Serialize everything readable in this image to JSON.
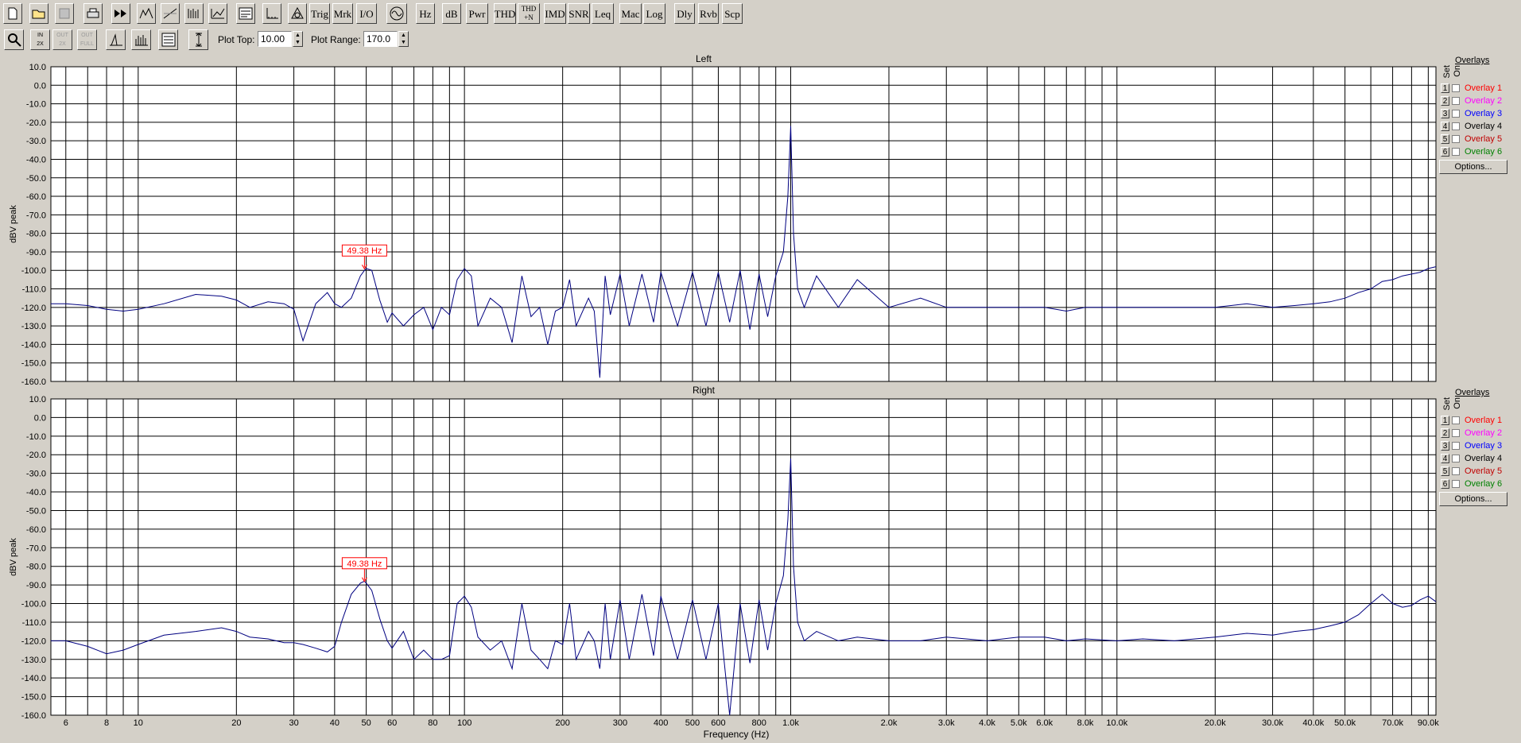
{
  "toolbar1": {
    "buttons": [
      {
        "name": "new-file-button",
        "icon": "new-file-icon",
        "label": ""
      },
      {
        "name": "open-file-button",
        "icon": "open-folder-icon",
        "label": ""
      },
      {
        "name": "save-file-button",
        "icon": "save-icon",
        "label": "",
        "disabled": true
      },
      {
        "name": "print-button",
        "icon": "printer-icon",
        "label": ""
      },
      {
        "name": "fast-forward-button",
        "icon": "fast-forward-icon",
        "label": ""
      },
      {
        "name": "spectrum-mode-button",
        "icon": "spectrum-icon",
        "label": ""
      },
      {
        "name": "waveform-button",
        "icon": "waveform-icon",
        "label": ""
      },
      {
        "name": "spectrogram-button",
        "icon": "spectrogram-icon",
        "label": ""
      },
      {
        "name": "3d-plot-button",
        "icon": "3d-plot-icon",
        "label": ""
      },
      {
        "name": "meters-button",
        "icon": "meters-icon",
        "label": ""
      },
      {
        "name": "axis-button",
        "icon": "axis-icon",
        "label": ""
      },
      {
        "name": "phase-button",
        "icon": "phase-icon",
        "label": ""
      },
      {
        "name": "trig-button",
        "icon": "",
        "label": "Trig"
      },
      {
        "name": "mrk-button",
        "icon": "",
        "label": "Mrk"
      },
      {
        "name": "io-button",
        "icon": "",
        "label": "I/O"
      },
      {
        "name": "generator-button",
        "icon": "generator-icon",
        "label": ""
      },
      {
        "name": "hz-button",
        "icon": "",
        "label": "Hz"
      },
      {
        "name": "db-button",
        "icon": "",
        "label": "dB"
      },
      {
        "name": "pwr-button",
        "icon": "",
        "label": "Pwr"
      },
      {
        "name": "thd-button",
        "icon": "",
        "label": "THD"
      },
      {
        "name": "thdn-button",
        "icon": "",
        "label": "THD\n+N"
      },
      {
        "name": "imd-button",
        "icon": "",
        "label": "IMD"
      },
      {
        "name": "snr-button",
        "icon": "",
        "label": "SNR"
      },
      {
        "name": "leq-button",
        "icon": "",
        "label": "Leq"
      },
      {
        "name": "mac-button",
        "icon": "",
        "label": "Mac"
      },
      {
        "name": "log-button",
        "icon": "",
        "label": "Log"
      },
      {
        "name": "dly-button",
        "icon": "",
        "label": "Dly"
      },
      {
        "name": "rvb-button",
        "icon": "",
        "label": "Rvb"
      },
      {
        "name": "scp-button",
        "icon": "",
        "label": "Scp"
      }
    ]
  },
  "toolbar2": {
    "buttons": [
      {
        "name": "zoom-button",
        "icon": "magnifier-icon",
        "label": ""
      },
      {
        "name": "zoom-in-2x-button",
        "icon": "zoom-in-icon",
        "label": "IN\n2X"
      },
      {
        "name": "zoom-out-2x-button",
        "icon": "zoom-out-icon",
        "label": "OUT\n2X",
        "disabled": true
      },
      {
        "name": "zoom-out-full-button",
        "icon": "zoom-out-full-icon",
        "label": "OUT\nFULL",
        "disabled": true
      },
      {
        "name": "peak-button",
        "icon": "peak-icon",
        "label": ""
      },
      {
        "name": "bars-button",
        "icon": "bars-icon",
        "label": ""
      },
      {
        "name": "settings-panel-button",
        "icon": "panel-icon",
        "label": ""
      },
      {
        "name": "vertical-scale-button",
        "icon": "vertical-scale-icon",
        "label": ""
      }
    ],
    "plot_top_label": "Plot Top:",
    "plot_top_value": "10.00",
    "plot_range_label": "Plot Range:",
    "plot_range_value": "170.0"
  },
  "overlays": {
    "title": "Overlays",
    "set_label": "Set",
    "on_label": "On",
    "items": [
      {
        "num": "1",
        "label": "Overlay 1",
        "color": "#ff0000"
      },
      {
        "num": "2",
        "label": "Overlay 2",
        "color": "#ff00ff"
      },
      {
        "num": "3",
        "label": "Overlay 3",
        "color": "#0000ff"
      },
      {
        "num": "4",
        "label": "Overlay 4",
        "color": "#000000"
      },
      {
        "num": "5",
        "label": "Overlay 5",
        "color": "#c00000"
      },
      {
        "num": "6",
        "label": "Overlay 6",
        "color": "#008000"
      }
    ],
    "options_label": "Options..."
  },
  "chart_data": [
    {
      "type": "line",
      "title": "Left",
      "ylabel": "dBV peak",
      "xlabel": "Frequency (Hz)",
      "xscale": "log",
      "xlim": [
        5.4,
        95000
      ],
      "ylim": [
        -160,
        10
      ],
      "yticks": [
        10,
        0,
        -10,
        -20,
        -30,
        -40,
        -50,
        -60,
        -70,
        -80,
        -90,
        -100,
        -110,
        -120,
        -130,
        -140,
        -150,
        -160
      ],
      "ytick_labels": [
        "10.0",
        "0.0",
        "-10.0",
        "-20.0",
        "-30.0",
        "-40.0",
        "-50.0",
        "-60.0",
        "-70.0",
        "-80.0",
        "-90.0",
        "-100.0",
        "-110.0",
        "-120.0",
        "-130.0",
        "-140.0",
        "-150.0",
        "-160.0"
      ],
      "line_color": "#000080",
      "marker": {
        "label": "49.38 Hz",
        "x": 49.38,
        "y": -100,
        "color": "#ff0000"
      },
      "series": [
        {
          "x": [
            5.4,
            6,
            7,
            8,
            9,
            10,
            12,
            15,
            18,
            20,
            22,
            25,
            28,
            30,
            32,
            35,
            38,
            40,
            42,
            45,
            48,
            49.38,
            50,
            52,
            55,
            58,
            60,
            65,
            70,
            75,
            80,
            85,
            90,
            95,
            100,
            105,
            110,
            120,
            130,
            140,
            150,
            160,
            170,
            180,
            190,
            200,
            210,
            220,
            240,
            250,
            260,
            270,
            280,
            300,
            320,
            350,
            380,
            400,
            450,
            500,
            550,
            600,
            650,
            700,
            750,
            800,
            850,
            900,
            950,
            980,
            1000,
            1020,
            1050,
            1100,
            1200,
            1400,
            1600,
            2000,
            2500,
            3000,
            4000,
            5000,
            6000,
            7000,
            8000,
            10000,
            12000,
            15000,
            20000,
            25000,
            30000,
            35000,
            40000,
            45000,
            50000,
            55000,
            60000,
            65000,
            70000,
            75000,
            80000,
            85000,
            90000,
            95000
          ],
          "y": [
            -118,
            -118,
            -119,
            -121,
            -122,
            -121,
            -118,
            -113,
            -114,
            -116,
            -120,
            -117,
            -118,
            -121,
            -138,
            -118,
            -112,
            -118,
            -120,
            -115,
            -103,
            -100,
            -99,
            -100,
            -116,
            -128,
            -123,
            -130,
            -124,
            -120,
            -132,
            -120,
            -124,
            -105,
            -99,
            -103,
            -130,
            -115,
            -120,
            -139,
            -103,
            -125,
            -120,
            -140,
            -122,
            -120,
            -105,
            -130,
            -115,
            -122,
            -158,
            -103,
            -124,
            -102,
            -130,
            -102,
            -128,
            -101,
            -130,
            -101,
            -130,
            -101,
            -128,
            -100,
            -132,
            -102,
            -125,
            -103,
            -90,
            -60,
            -22,
            -80,
            -110,
            -120,
            -103,
            -120,
            -105,
            -120,
            -115,
            -120,
            -120,
            -120,
            -120,
            -122,
            -120,
            -120,
            -120,
            -120,
            -120,
            -118,
            -120,
            -119,
            -118,
            -117,
            -115,
            -112,
            -110,
            -106,
            -105,
            -103,
            -102,
            -101,
            -99,
            -98
          ]
        }
      ]
    },
    {
      "type": "line",
      "title": "Right",
      "ylabel": "dBV peak",
      "xlabel": "Frequency (Hz)",
      "xscale": "log",
      "xlim": [
        5.4,
        95000
      ],
      "ylim": [
        -160,
        10
      ],
      "yticks": [
        10,
        0,
        -10,
        -20,
        -30,
        -40,
        -50,
        -60,
        -70,
        -80,
        -90,
        -100,
        -110,
        -120,
        -130,
        -140,
        -150,
        -160
      ],
      "ytick_labels": [
        "10.0",
        "0.0",
        "-10.0",
        "-20.0",
        "-30.0",
        "-40.0",
        "-50.0",
        "-60.0",
        "-70.0",
        "-80.0",
        "-90.0",
        "-100.0",
        "-110.0",
        "-120.0",
        "-130.0",
        "-140.0",
        "-150.0",
        "-160.0"
      ],
      "xticks": [
        6,
        8,
        10,
        20,
        30,
        40,
        50,
        60,
        80,
        100,
        200,
        300,
        400,
        500,
        600,
        800,
        1000,
        2000,
        3000,
        4000,
        5000,
        6000,
        8000,
        10000,
        20000,
        30000,
        40000,
        50000,
        70000,
        90000
      ],
      "xtick_labels": [
        "6",
        "8",
        "10",
        "20",
        "30",
        "40",
        "50",
        "60",
        "80",
        "100",
        "200",
        "300",
        "400",
        "500",
        "600",
        "800",
        "1.0k",
        "2.0k",
        "3.0k",
        "4.0k",
        "5.0k",
        "6.0k",
        "8.0k",
        "10.0k",
        "20.0k",
        "30.0k",
        "40.0k",
        "50.0k",
        "70.0k",
        "90.0k"
      ],
      "line_color": "#000080",
      "marker": {
        "label": "49.38 Hz",
        "x": 49.38,
        "y": -89,
        "color": "#ff0000"
      },
      "series": [
        {
          "x": [
            5.4,
            6,
            7,
            8,
            9,
            10,
            12,
            15,
            18,
            20,
            22,
            25,
            28,
            30,
            32,
            35,
            38,
            40,
            42,
            45,
            48,
            49.38,
            50,
            52,
            55,
            58,
            60,
            65,
            70,
            75,
            80,
            85,
            90,
            95,
            100,
            105,
            110,
            120,
            130,
            140,
            150,
            160,
            170,
            180,
            190,
            200,
            210,
            220,
            240,
            250,
            260,
            270,
            280,
            300,
            320,
            350,
            380,
            400,
            450,
            500,
            550,
            600,
            650,
            700,
            750,
            800,
            850,
            900,
            950,
            980,
            1000,
            1020,
            1050,
            1100,
            1200,
            1400,
            1600,
            2000,
            2500,
            3000,
            4000,
            5000,
            6000,
            7000,
            8000,
            10000,
            12000,
            15000,
            20000,
            25000,
            30000,
            35000,
            40000,
            45000,
            50000,
            55000,
            60000,
            65000,
            70000,
            75000,
            80000,
            85000,
            90000,
            95000
          ],
          "y": [
            -120,
            -120,
            -123,
            -127,
            -125,
            -122,
            -117,
            -115,
            -113,
            -115,
            -118,
            -119,
            -121,
            -121,
            -122,
            -124,
            -126,
            -123,
            -110,
            -95,
            -89,
            -88,
            -89,
            -93,
            -108,
            -120,
            -124,
            -115,
            -130,
            -125,
            -130,
            -130,
            -128,
            -100,
            -96,
            -102,
            -118,
            -125,
            -120,
            -135,
            -100,
            -125,
            -130,
            -135,
            -120,
            -122,
            -100,
            -130,
            -115,
            -120,
            -135,
            -100,
            -130,
            -98,
            -130,
            -95,
            -128,
            -96,
            -130,
            -98,
            -130,
            -100,
            -160,
            -100,
            -132,
            -98,
            -125,
            -100,
            -85,
            -55,
            -22,
            -80,
            -110,
            -120,
            -115,
            -120,
            -118,
            -120,
            -120,
            -118,
            -120,
            -118,
            -118,
            -120,
            -119,
            -120,
            -119,
            -120,
            -118,
            -116,
            -117,
            -115,
            -114,
            -112,
            -110,
            -106,
            -100,
            -95,
            -100,
            -102,
            -101,
            -98,
            -96,
            -99
          ]
        }
      ]
    }
  ]
}
